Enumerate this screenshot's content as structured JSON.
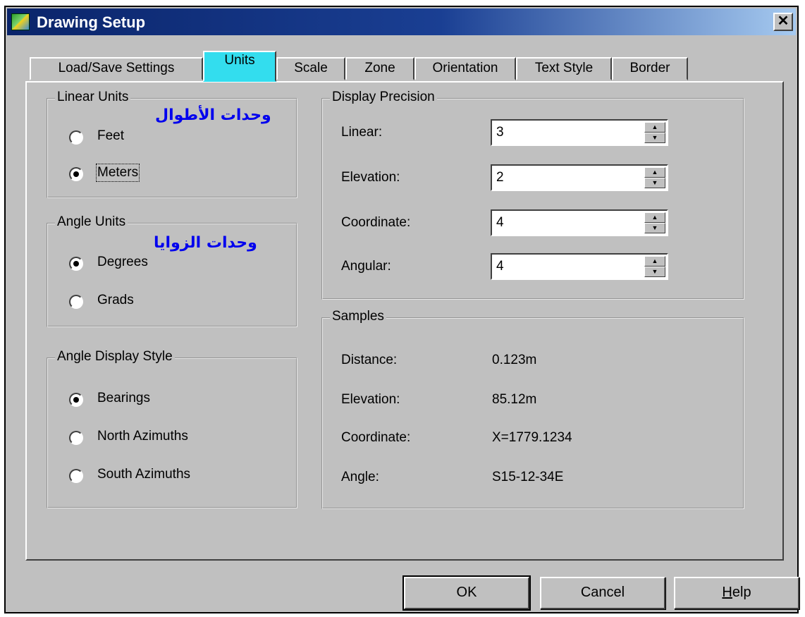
{
  "window": {
    "title": "Drawing Setup",
    "close_glyph": "✕",
    "app_icon": "drawing-setup-icon"
  },
  "tabs": [
    {
      "label": "Load/Save Settings",
      "active": false
    },
    {
      "label": "Units",
      "active": true
    },
    {
      "label": "Scale",
      "active": false
    },
    {
      "label": "Zone",
      "active": false
    },
    {
      "label": "Orientation",
      "active": false
    },
    {
      "label": "Text Style",
      "active": false
    },
    {
      "label": "Border",
      "active": false
    }
  ],
  "linear_units": {
    "title": "Linear Units",
    "annotation": "وحدات الأطوال",
    "options": [
      {
        "label": "Feet",
        "selected": false
      },
      {
        "label": "Meters",
        "selected": true
      }
    ]
  },
  "angle_units": {
    "title": "Angle Units",
    "annotation": "وحدات الزوايا",
    "options": [
      {
        "label": "Degrees",
        "selected": true
      },
      {
        "label": "Grads",
        "selected": false
      }
    ]
  },
  "angle_display": {
    "title": "Angle Display Style",
    "options": [
      {
        "label": "Bearings",
        "selected": true
      },
      {
        "label": "North Azimuths",
        "selected": false
      },
      {
        "label": "South Azimuths",
        "selected": false
      }
    ]
  },
  "precision": {
    "title": "Display Precision",
    "fields": [
      {
        "label": "Linear:",
        "value": "3"
      },
      {
        "label": "Elevation:",
        "value": "2"
      },
      {
        "label": "Coordinate:",
        "value": "4"
      },
      {
        "label": "Angular:",
        "value": "4"
      }
    ]
  },
  "samples": {
    "title": "Samples",
    "rows": [
      {
        "label": "Distance:",
        "value": "0.123m"
      },
      {
        "label": "Elevation:",
        "value": "85.12m"
      },
      {
        "label": "Coordinate:",
        "value": "X=1779.1234"
      },
      {
        "label": "Angle:",
        "value": "S15-12-34E"
      }
    ]
  },
  "buttons": {
    "ok": "OK",
    "cancel": "Cancel",
    "help_mnemonic": "H",
    "help_rest": "elp"
  },
  "colors": {
    "dialog_bg": "#c0c0c0",
    "active_tab": "#33ddee",
    "annotation_text": "#0000ee",
    "title_bar": "#0a246a"
  }
}
